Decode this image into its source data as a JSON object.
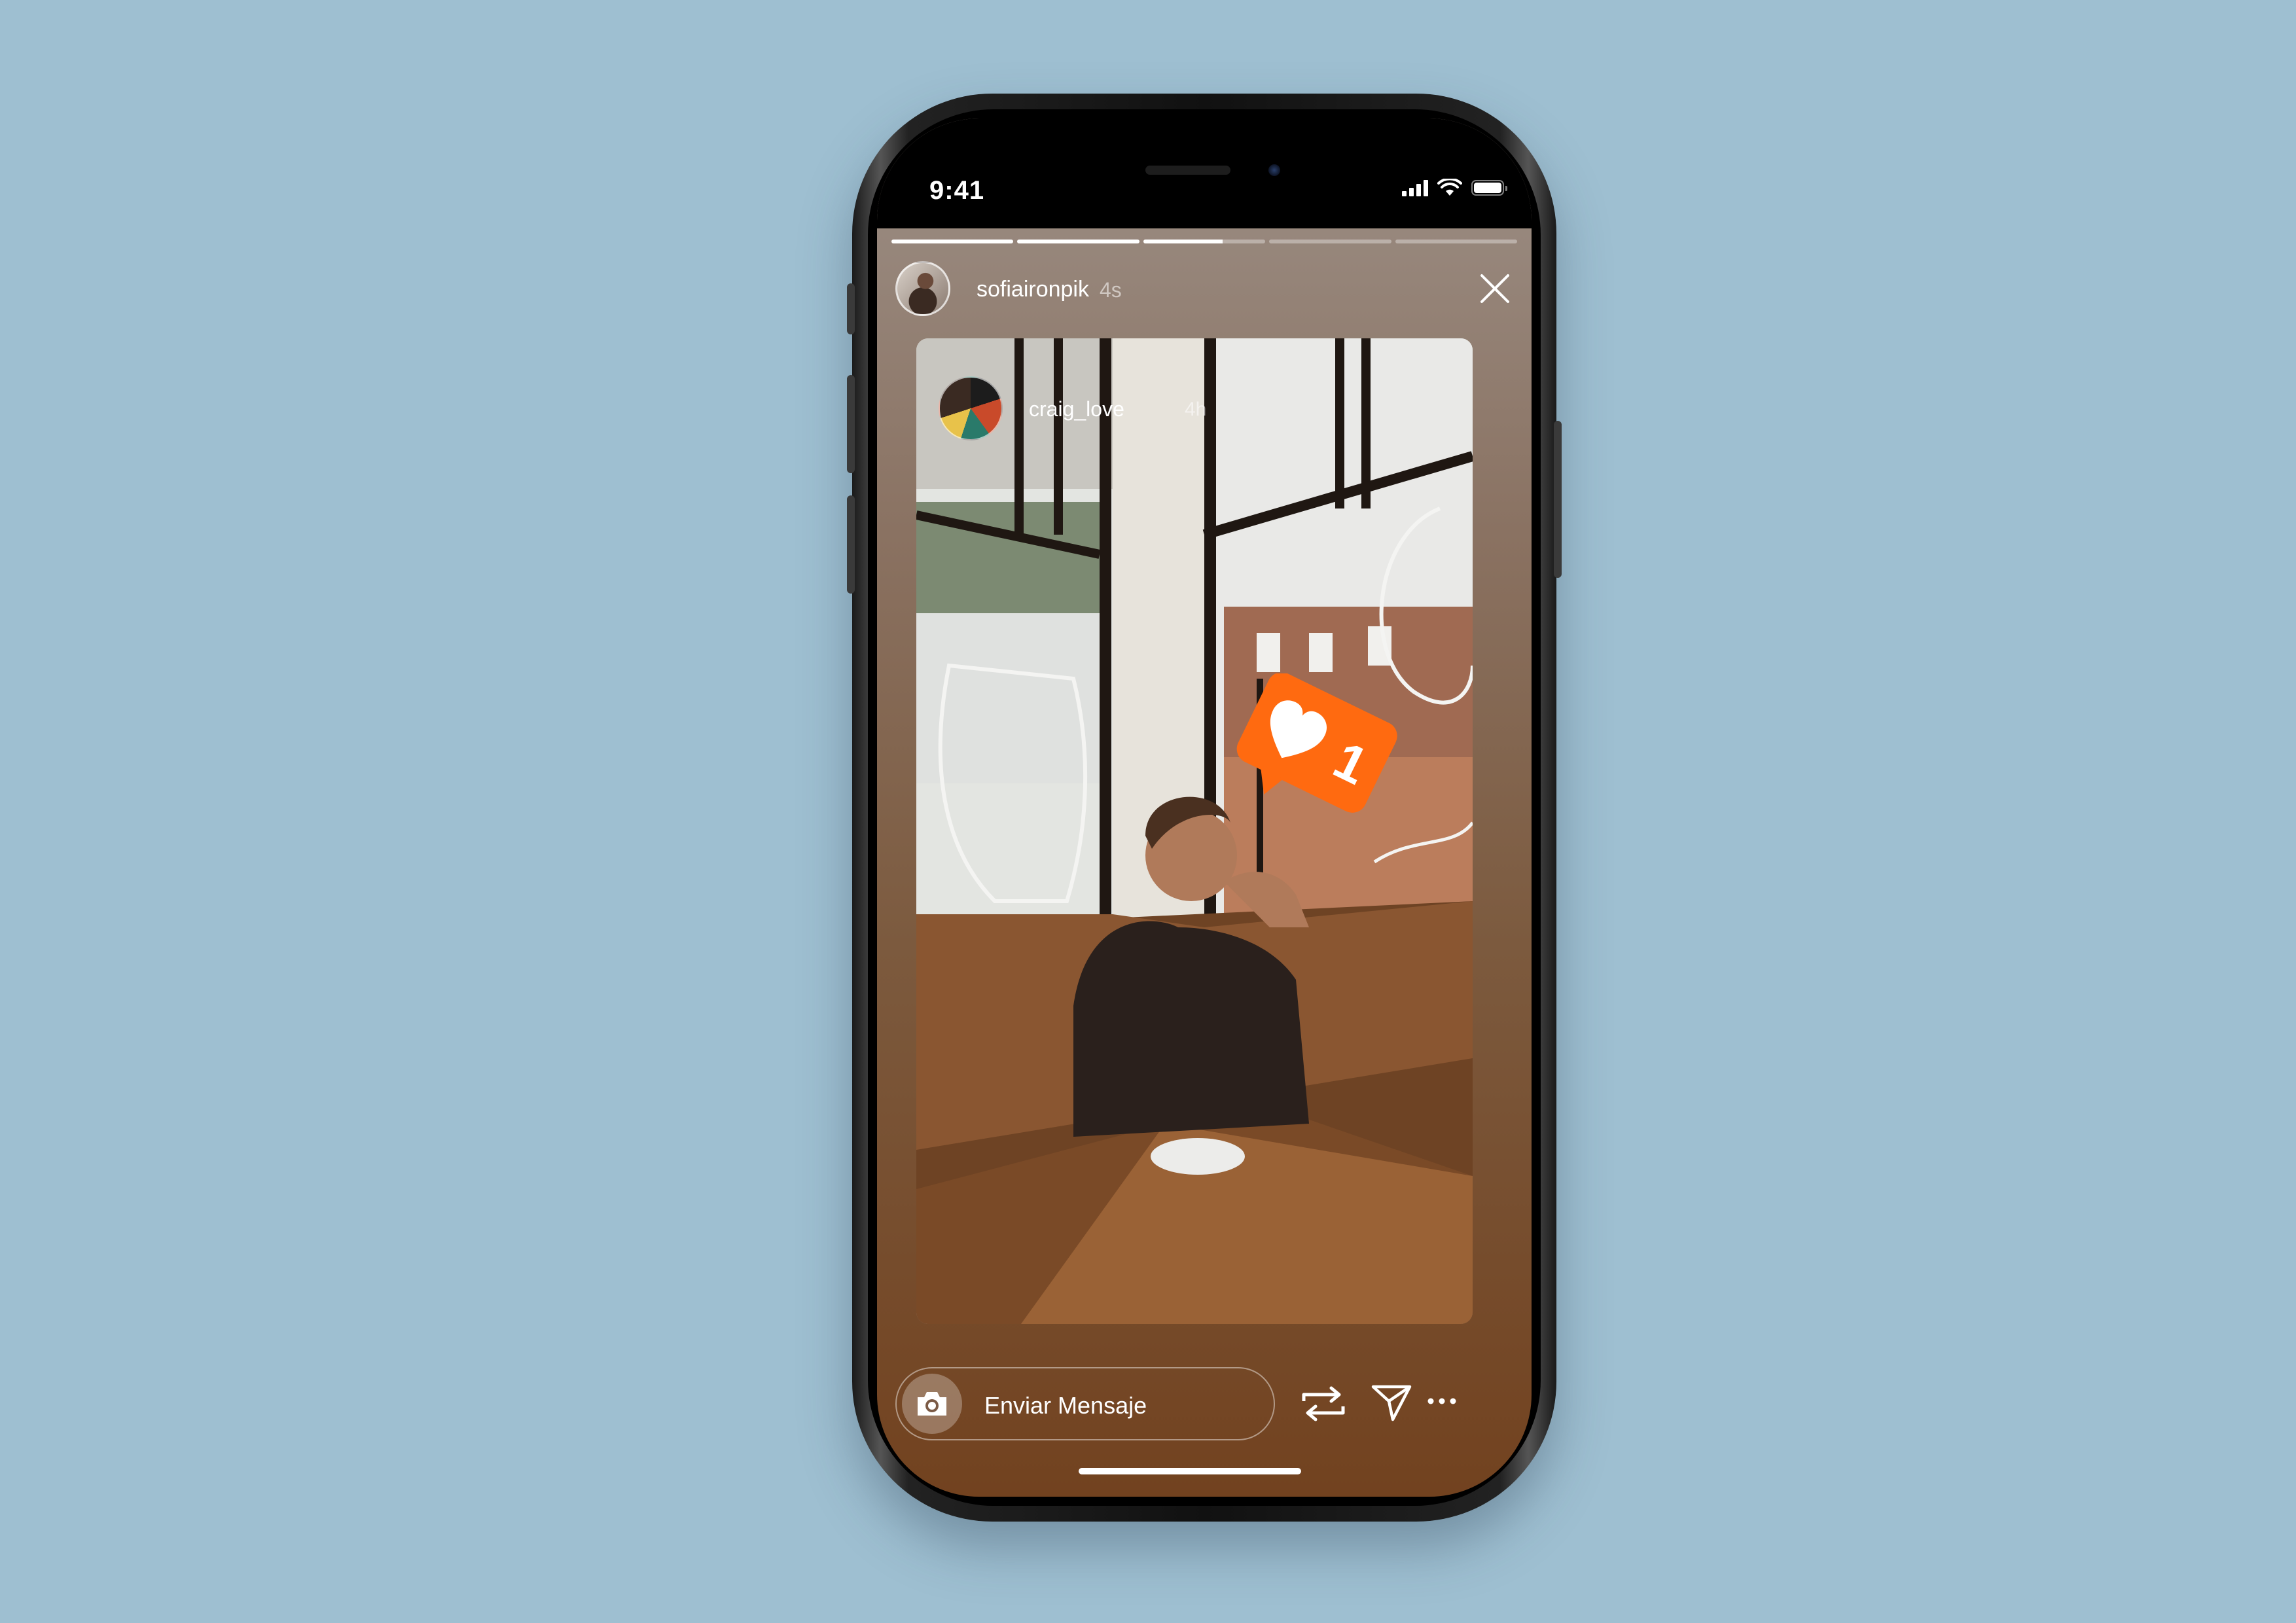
{
  "status_bar": {
    "time": "9:41",
    "icons": [
      "cellular-signal-icon",
      "wifi-icon",
      "battery-icon"
    ]
  },
  "story": {
    "progress": [
      1,
      1,
      0.65,
      0,
      0
    ],
    "author": {
      "username": "sofiaironpik",
      "elapsed": "4s"
    },
    "close_icon": "close-icon",
    "shared_post": {
      "username": "craig_love",
      "elapsed": "4h",
      "like_sticker_count": "1",
      "like_sticker_color": "#ff6a10"
    }
  },
  "bottom_bar": {
    "message_placeholder": "Enviar Mensaje",
    "icons": [
      "camera-icon",
      "repost-icon",
      "send-icon",
      "more-icon"
    ]
  },
  "colors": {
    "background": "#9ebfd1",
    "like_orange": "#ff6a10"
  }
}
